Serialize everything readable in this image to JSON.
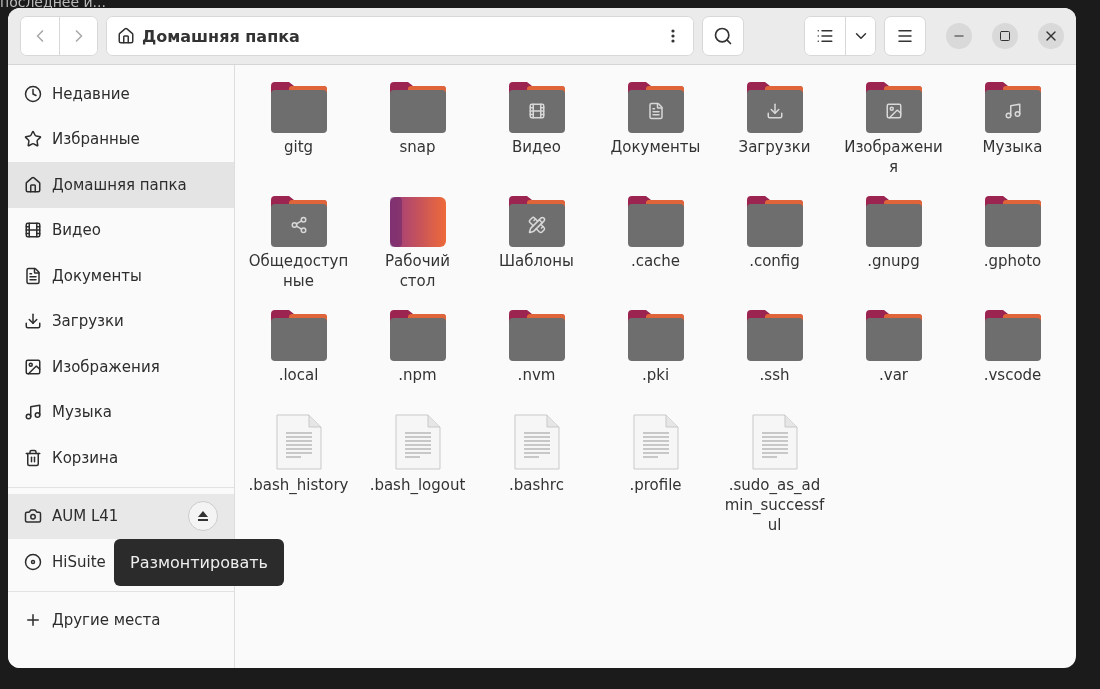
{
  "desktop": {
    "text": "последнее и..."
  },
  "header": {
    "location": "Домашняя папка"
  },
  "sidebar": {
    "places": [
      {
        "kind": "recent",
        "label": "Недавние",
        "selected": false
      },
      {
        "kind": "starred",
        "label": "Избранные",
        "selected": false
      },
      {
        "kind": "home",
        "label": "Домашняя папка",
        "selected": true
      },
      {
        "kind": "video",
        "label": "Видео",
        "selected": false
      },
      {
        "kind": "documents",
        "label": "Документы",
        "selected": false
      },
      {
        "kind": "downloads",
        "label": "Загрузки",
        "selected": false
      },
      {
        "kind": "pictures",
        "label": "Изображения",
        "selected": false
      },
      {
        "kind": "music",
        "label": "Музыка",
        "selected": false
      },
      {
        "kind": "trash",
        "label": "Корзина",
        "selected": false
      }
    ],
    "devices": [
      {
        "kind": "camera",
        "label": "AUM L41",
        "hovered": true,
        "eject": true
      },
      {
        "kind": "disc",
        "label": "HiSuite",
        "hovered": false,
        "eject": false
      }
    ],
    "other": [
      {
        "kind": "add",
        "label": "Другие места",
        "selected": false
      }
    ]
  },
  "tooltip": {
    "text": "Размонтировать"
  },
  "files": [
    {
      "kind": "folder",
      "name": "gitg"
    },
    {
      "kind": "folder",
      "name": "snap"
    },
    {
      "kind": "video",
      "name": "Видео"
    },
    {
      "kind": "documents",
      "name": "Документы"
    },
    {
      "kind": "downloads",
      "name": "Загрузки"
    },
    {
      "kind": "pictures",
      "name": "Изображения"
    },
    {
      "kind": "music",
      "name": "Музыка"
    },
    {
      "kind": "public",
      "name": "Общедоступные"
    },
    {
      "kind": "desktop",
      "name": "Рабочий стол"
    },
    {
      "kind": "templates",
      "name": "Шаблоны"
    },
    {
      "kind": "folder",
      "name": ".cache"
    },
    {
      "kind": "folder",
      "name": ".config"
    },
    {
      "kind": "folder",
      "name": ".gnupg"
    },
    {
      "kind": "folder",
      "name": ".gphoto"
    },
    {
      "kind": "folder",
      "name": ".local"
    },
    {
      "kind": "folder",
      "name": ".npm"
    },
    {
      "kind": "folder",
      "name": ".nvm"
    },
    {
      "kind": "folder",
      "name": ".pki"
    },
    {
      "kind": "folder",
      "name": ".ssh"
    },
    {
      "kind": "folder",
      "name": ".var"
    },
    {
      "kind": "folder",
      "name": ".vscode"
    },
    {
      "kind": "file",
      "name": ".bash_history"
    },
    {
      "kind": "file",
      "name": ".bash_logout"
    },
    {
      "kind": "file",
      "name": ".bashrc"
    },
    {
      "kind": "file",
      "name": ".profile"
    },
    {
      "kind": "file",
      "name": ".sudo_as_admin_successful"
    }
  ]
}
